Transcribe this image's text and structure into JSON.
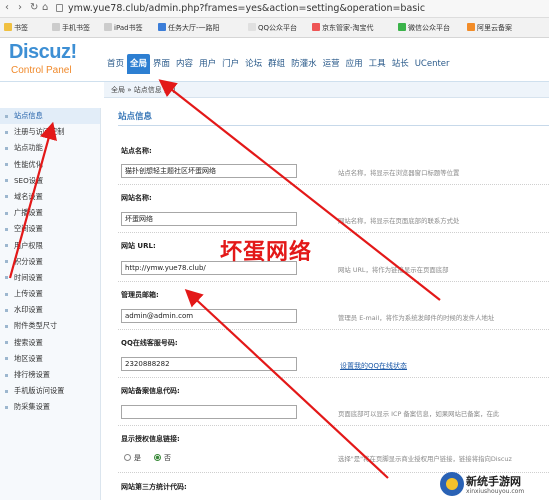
{
  "browser": {
    "url": "ymw.yue78.club/admin.php?frames=yes&action=setting&operation=basic",
    "bookmarks": [
      "书签",
      "手机书签",
      "iPad书签",
      "任务大厅-一路阳",
      "QQ公众平台",
      "京东管家-淘宝代",
      "微信公众平台",
      "阿里云备案"
    ]
  },
  "header": {
    "logo": "Discuz!",
    "subtitle": "Control Panel",
    "nav": [
      "首页",
      "全局",
      "界面",
      "内容",
      "用户",
      "门户",
      "论坛",
      "群组",
      "防灌水",
      "运营",
      "应用",
      "工具",
      "站长",
      "UCenter"
    ],
    "active_nav": "全局"
  },
  "breadcrumb": "全局 » 站点信息 [+]",
  "sidebar": {
    "items": [
      "站点信息",
      "注册与访问控制",
      "站点功能",
      "性能优化",
      "SEO设置",
      "域名设置",
      "广播设置",
      "空间设置",
      "用户权限",
      "积分设置",
      "时间设置",
      "上传设置",
      "水印设置",
      "附件类型尺寸",
      "搜索设置",
      "地区设置",
      "排行榜设置",
      "手机版访问设置",
      "防采集设置"
    ],
    "active": "站点信息"
  },
  "main": {
    "section_title": "站点信息",
    "fields": [
      {
        "label": "站点名称:",
        "value": "猫扑创想轻主题社区坏蛋网络",
        "tip": "站点名称，将显示在浏览器窗口标题等位置"
      },
      {
        "label": "网站名称:",
        "value": "坏蛋网络",
        "tip": "网站名称，将显示在页面底部的联系方式处"
      },
      {
        "label": "网站 URL:",
        "value": "http://ymw.yue78.club/",
        "tip": "网站 URL，将作为链接显示在页面底部"
      },
      {
        "label": "管理员邮箱:",
        "value": "admin@admin.com",
        "tip": "管理员 E-mail，将作为系统发邮件的时候的发件人地址"
      },
      {
        "label": "QQ在线客服号码:",
        "value": "2320888282",
        "link": "设置我的QQ在线状态"
      },
      {
        "label": "网站备案信息代码:",
        "value": "",
        "tip": "页面底部可以显示 ICP 备案信息，如果网站已备案，在此"
      },
      {
        "label": "显示授权信息链接:",
        "tip": "选择\"是\"将在页脚显示商业授权用户链接，链接将指向Discuz"
      },
      {
        "label": "网站第三方统计代码:"
      }
    ],
    "radio_yes": "是",
    "radio_no": "否",
    "radio_selected": "否"
  },
  "watermark": "坏蛋网络",
  "corner_logo": {
    "title": "新统手游网",
    "subtitle": "xinxiushouyou.com"
  },
  "colors": {
    "accent": "#2d7fd2",
    "annotation": "#e31818"
  }
}
